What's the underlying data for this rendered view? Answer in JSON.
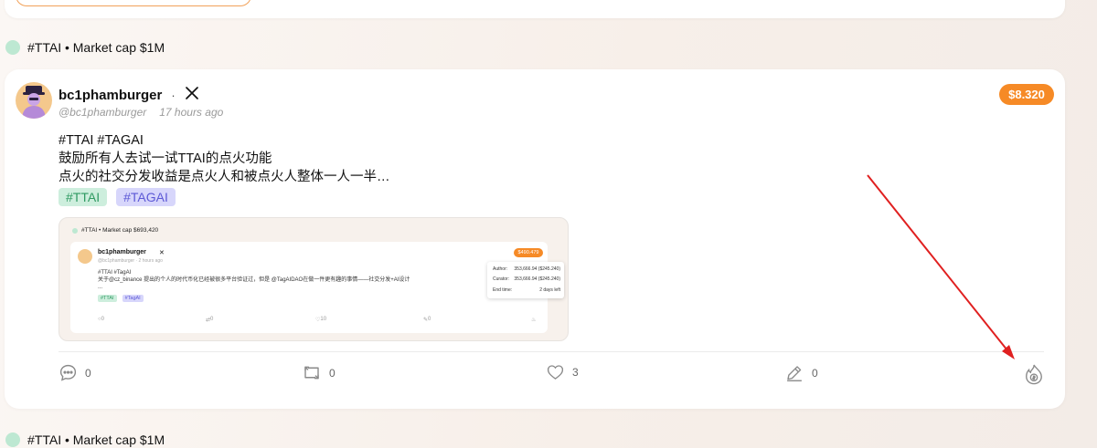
{
  "top_group": {
    "label": "#TTAI • Market cap $1M"
  },
  "post": {
    "author": "bc1phamburger",
    "separator": "·",
    "handle": "@bc1phamburger",
    "time": "17 hours ago",
    "price": "$8.320",
    "lines": [
      "#TTAI #TAGAI",
      "鼓励所有人去试一试TTAI的点火功能",
      "点火的社交分发收益是点火人和被点火人整体一人一半…"
    ],
    "tags": [
      "#TTAI",
      "#TAGAI"
    ],
    "embed": {
      "header": "#TTAI • Market cap $693,420",
      "author": "bc1phamburger",
      "meta": "@bc1phamburger · 2 hours ago",
      "price": "$490.479",
      "line1": "#TTAI #TagAI",
      "line2": "关于@cz_binance 提出的个人的时代币化已经被很多平台验证过，但是 @TagAIDAO在做一件更有趣的事情——社交分发+AI设计",
      "line3": "...",
      "tags": [
        "#TTAI",
        "#TagAI"
      ],
      "tooltip": {
        "author_label": "Author:",
        "author_value": "353,666.94 ($245.240)",
        "curator_label": "Curator:",
        "curator_value": "353,666.94 ($245.240)",
        "end_label": "End time:",
        "end_value": "2 days left"
      },
      "counts": {
        "comments": "0",
        "retweets": "0",
        "likes": "10",
        "edits": "0"
      }
    },
    "actions": {
      "comments": "0",
      "retweets": "0",
      "likes": "3",
      "edits": "0"
    }
  },
  "bottom_group": {
    "label": "#TTAI • Market cap $1M"
  },
  "colors": {
    "accent": "#f68a26",
    "annotation_arrow": "#e02020"
  },
  "icons": [
    "x-logo-icon",
    "comment-icon",
    "retweet-icon",
    "heart-icon",
    "edit-icon",
    "ignite-icon"
  ]
}
